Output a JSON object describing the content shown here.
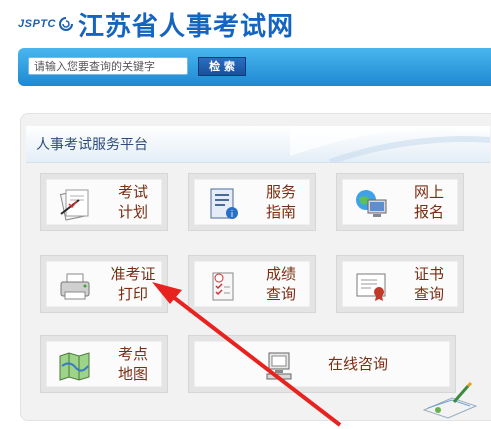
{
  "header": {
    "logo_mark": "JSPTC",
    "site_title": "江苏省人事考试网"
  },
  "search": {
    "placeholder": "请输入您要查询的关键字",
    "button_label": "检 索"
  },
  "panel": {
    "title": "人事考试服务平台",
    "tiles": [
      {
        "label": "考试\n计划",
        "icon": "exam-plan-icon"
      },
      {
        "label": "服务\n指南",
        "icon": "service-guide-icon"
      },
      {
        "label": "网上\n报名",
        "icon": "online-registration-icon"
      },
      {
        "label": "准考证\n打印",
        "icon": "admission-ticket-print-icon"
      },
      {
        "label": "成绩\n查询",
        "icon": "score-query-icon"
      },
      {
        "label": "证书\n查询",
        "icon": "certificate-query-icon"
      },
      {
        "label": "考点\n地图",
        "icon": "exam-site-map-icon"
      },
      {
        "label": "在线咨询",
        "icon": "online-consult-icon"
      }
    ]
  },
  "colors": {
    "title_blue": "#1565c0",
    "search_bar": "#1e88d2",
    "tile_text": "#7a2e12",
    "annotation_arrow": "#e8231f"
  }
}
